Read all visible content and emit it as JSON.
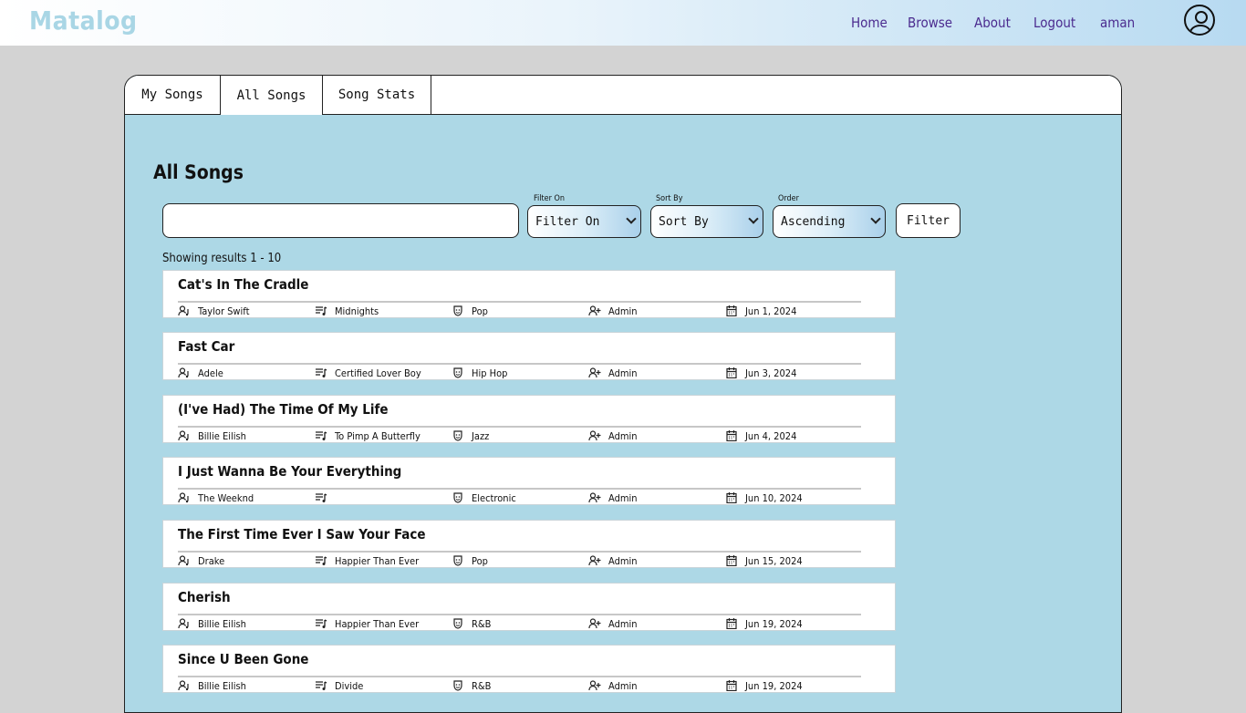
{
  "header": {
    "brand": "Matalog",
    "nav": [
      "Home",
      "Browse",
      "About",
      "Logout",
      "aman"
    ]
  },
  "tabs": [
    {
      "label": "My Songs",
      "active": false
    },
    {
      "label": "All Songs",
      "active": true
    },
    {
      "label": "Song Stats",
      "active": false
    }
  ],
  "page": {
    "title": "All Songs",
    "search_value": "",
    "filter_on": {
      "label": "Filter On",
      "value": "Filter On"
    },
    "sort_by": {
      "label": "Sort By",
      "value": "Sort By"
    },
    "order": {
      "label": "Order",
      "value": "Ascending"
    },
    "filter_button": "Filter",
    "results_text": "Showing results 1 - 10"
  },
  "songs": [
    {
      "title": "Cat's In The Cradle",
      "artist": "Taylor Swift",
      "album": "Midnights",
      "genre": "Pop",
      "added_by": "Admin",
      "date": "Jun 1, 2024"
    },
    {
      "title": "Fast Car",
      "artist": "Adele",
      "album": "Certified Lover Boy",
      "genre": "Hip Hop",
      "added_by": "Admin",
      "date": "Jun 3, 2024"
    },
    {
      "title": "(I've Had) The Time Of My Life",
      "artist": "Billie Eilish",
      "album": "To Pimp A Butterfly",
      "genre": "Jazz",
      "added_by": "Admin",
      "date": "Jun 4, 2024"
    },
    {
      "title": "I Just Wanna Be Your Everything",
      "artist": "The Weeknd",
      "album": "",
      "genre": "Electronic",
      "added_by": "Admin",
      "date": "Jun 10, 2024"
    },
    {
      "title": "The First Time Ever I Saw Your Face",
      "artist": "Drake",
      "album": "Happier Than Ever",
      "genre": "Pop",
      "added_by": "Admin",
      "date": "Jun 15, 2024"
    },
    {
      "title": "Cherish",
      "artist": "Billie Eilish",
      "album": "Happier Than Ever",
      "genre": "R&B",
      "added_by": "Admin",
      "date": "Jun 19, 2024"
    },
    {
      "title": "Since U Been Gone",
      "artist": "Billie Eilish",
      "album": "Divide",
      "genre": "R&B",
      "added_by": "Admin",
      "date": "Jun 19, 2024"
    }
  ],
  "colors": {
    "panel_bg": "#add8e6",
    "brand": "#a9d6e5",
    "nav_text": "#4b2b8f",
    "page_bg": "#d3d3d3"
  },
  "icons": [
    "artist-icon",
    "album-icon",
    "genre-icon",
    "added-by-icon",
    "calendar-icon",
    "user-circle-icon",
    "chevron-down-icon"
  ]
}
